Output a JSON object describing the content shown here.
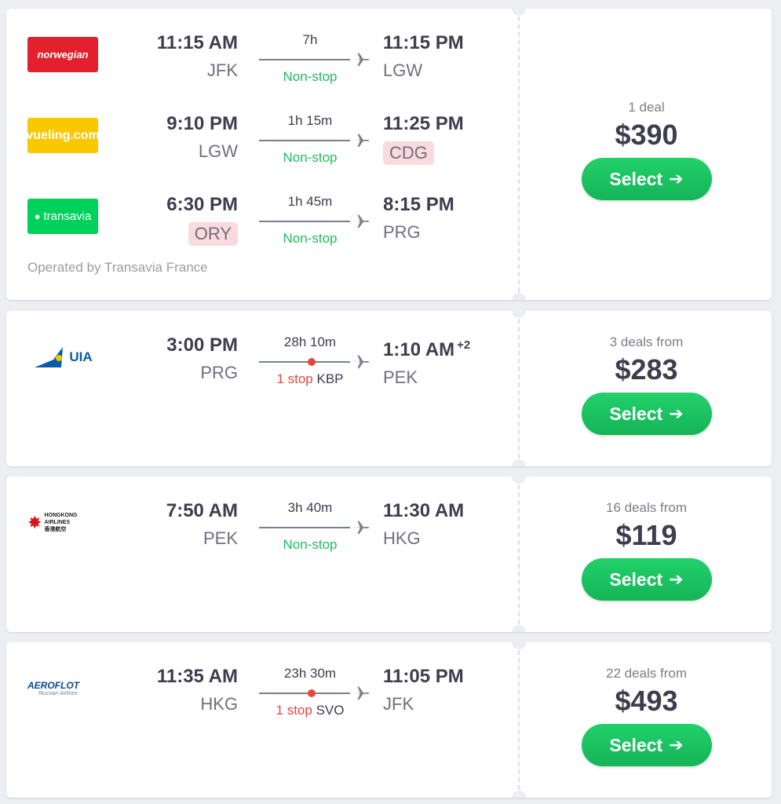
{
  "cards": [
    {
      "deals": "1 deal",
      "price": "$390",
      "select_label": "Select",
      "operated_by": "Operated by Transavia France",
      "legs": [
        {
          "airline": "norwegian",
          "dep_time": "11:15 AM",
          "dep_code": "JFK",
          "duration": "7h",
          "stops": "Non-stop",
          "arr_time": "11:15 PM",
          "arr_code": "LGW"
        },
        {
          "airline": "vueling.com",
          "dep_time": "9:10 PM",
          "dep_code": "LGW",
          "duration": "1h 15m",
          "stops": "Non-stop",
          "arr_time": "11:25 PM",
          "arr_code": "CDG"
        },
        {
          "airline": "transavia",
          "dep_time": "6:30 PM",
          "dep_code": "ORY",
          "duration": "1h 45m",
          "stops": "Non-stop",
          "arr_time": "8:15 PM",
          "arr_code": "PRG"
        }
      ]
    },
    {
      "deals": "3 deals from",
      "price": "$283",
      "select_label": "Select",
      "legs": [
        {
          "airline": "UIA",
          "dep_time": "3:00 PM",
          "dep_code": "PRG",
          "duration": "28h 10m",
          "stops": "1 stop",
          "stop_code": "KBP",
          "arr_time": "1:10 AM",
          "day_offset": "+2",
          "arr_code": "PEK"
        }
      ]
    },
    {
      "deals": "16 deals from",
      "price": "$119",
      "select_label": "Select",
      "legs": [
        {
          "airline": "HONGKONG AIRLINES",
          "airline_cn": "香港航空",
          "dep_time": "7:50 AM",
          "dep_code": "PEK",
          "duration": "3h 40m",
          "stops": "Non-stop",
          "arr_time": "11:30 AM",
          "arr_code": "HKG"
        }
      ]
    },
    {
      "deals": "22 deals from",
      "price": "$493",
      "select_label": "Select",
      "legs": [
        {
          "airline": "AEROFLOT",
          "airline_sub": "Russian Airlines",
          "dep_time": "11:35 AM",
          "dep_code": "HKG",
          "duration": "23h 30m",
          "stops": "1 stop",
          "stop_code": "SVO",
          "arr_time": "11:05 PM",
          "arr_code": "JFK"
        }
      ]
    }
  ],
  "icons": {
    "plane": "plane-icon",
    "arrow": "arrow-right-icon"
  },
  "colors": {
    "select_green": "#1fc763",
    "nonstop_green": "#1fbb5e",
    "stop_red": "#e8453c",
    "warn_bg": "#fadadd",
    "norwegian_red": "#e3202e",
    "vueling_yellow": "#f9c800",
    "transavia_green": "#00d15b"
  }
}
